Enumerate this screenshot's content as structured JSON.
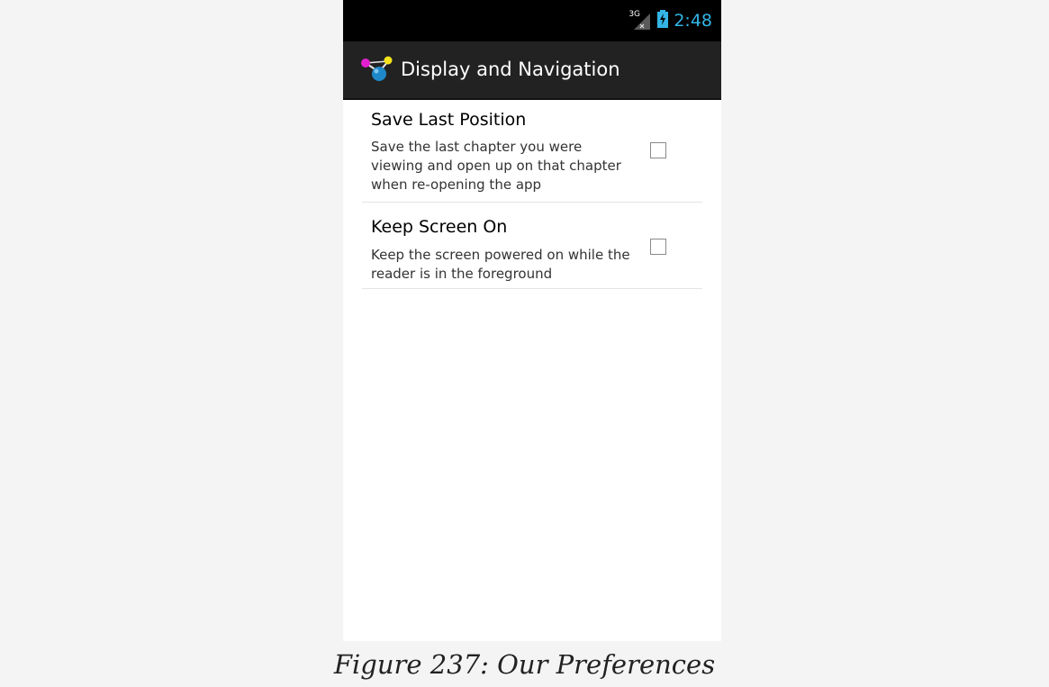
{
  "status_bar": {
    "network_label": "3G",
    "time": "2:48",
    "icons": [
      "signal-3g-icon",
      "battery-charging-icon"
    ],
    "time_color": "#33b5e5"
  },
  "action_bar": {
    "icon": "app-molecule-icon",
    "title": "Display and Navigation"
  },
  "preferences": [
    {
      "title": "Save Last Position",
      "summary": "Save the last chapter you were viewing and open up on that chapter when re-opening the app",
      "checked": false
    },
    {
      "title": "Keep Screen On",
      "summary": "Keep the screen powered on while the reader is in the foreground",
      "checked": false
    }
  ],
  "caption": "Figure 237: Our Preferences",
  "colors": {
    "page_background": "#f4f4f4",
    "status_bar": "#000000",
    "action_bar": "#222222",
    "accent": "#33b5e5"
  }
}
